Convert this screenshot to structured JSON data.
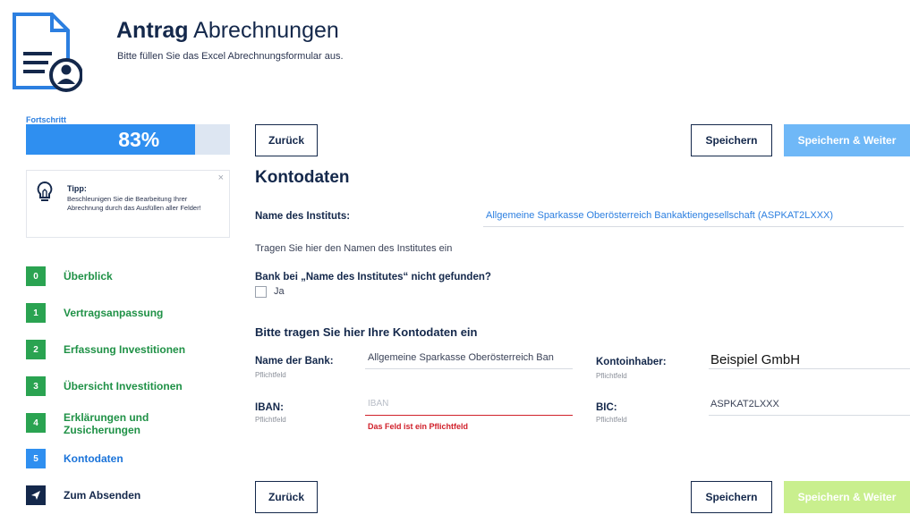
{
  "header": {
    "title_bold": "Antrag",
    "title_rest": "Abrechnungen",
    "subtitle": "Bitte füllen Sie das Excel Abrechnungsformular aus."
  },
  "progress": {
    "label": "Fortschritt",
    "value_text": "83%",
    "fraction": 0.83
  },
  "tip": {
    "title": "Tipp:",
    "text": "Beschleunigen Sie die Bearbeitung Ihrer Abrechnung durch das Ausfüllen aller Felder!",
    "close": "×"
  },
  "steps": [
    {
      "num": "0",
      "label": "Überblick"
    },
    {
      "num": "1",
      "label": "Vertragsanpassung"
    },
    {
      "num": "2",
      "label": "Erfassung Investitionen"
    },
    {
      "num": "3",
      "label": "Übersicht Investitionen"
    },
    {
      "num": "4",
      "label": "Erklärungen und Zusicherungen"
    },
    {
      "num": "5",
      "label": "Kontodaten"
    },
    {
      "num": "",
      "label": "Zum Absenden"
    }
  ],
  "buttons": {
    "back": "Zurück",
    "save": "Speichern",
    "save_next": "Speichern & Weiter"
  },
  "form": {
    "heading": "Kontodaten",
    "institute_label": "Name des Instituts:",
    "institute_value": "Allgemeine Sparkasse Oberösterreich Bankaktiengesellschaft (ASPKAT2LXXX)",
    "institute_hint": "Tragen Sie hier den Namen des Institutes ein",
    "not_found_label": "Bank bei „Name des Institutes“ nicht gefunden?",
    "checkbox_label": "Ja",
    "section_heading": "Bitte tragen Sie hier Ihre Kontodaten ein",
    "bank_label": "Name der Bank:",
    "bank_value": "Allgemeine Sparkasse Oberösterreich Ban",
    "owner_label": "Kontoinhaber:",
    "owner_value": "Beispiel GmbH",
    "iban_label": "IBAN:",
    "iban_placeholder": "IBAN",
    "iban_error": "Das Feld ist ein Pflichtfeld",
    "bic_label": "BIC:",
    "bic_value": "ASPKAT2LXXX",
    "required": "Pflichtfeld"
  },
  "colors": {
    "navy": "#14284b",
    "accent_blue": "#2f8ff0",
    "step_green": "#2aa351",
    "error_red": "#d0202a"
  }
}
